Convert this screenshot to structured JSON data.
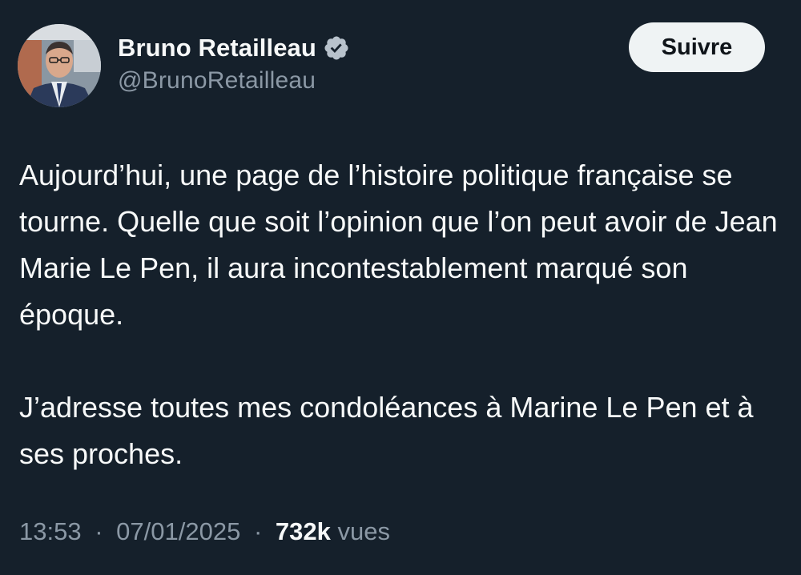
{
  "author": {
    "display_name": "Bruno Retailleau",
    "handle": "@BrunoRetailleau",
    "verified_icon": "verified-badge-icon",
    "avatar": "profile-photo"
  },
  "follow_button": {
    "label": "Suivre"
  },
  "tweet": {
    "paragraphs": [
      "Aujourd’hui, une page de l’histoire politique française se tourne. Quelle que soit l’opinion que l’on peut avoir de Jean Marie Le Pen, il aura incontestablement marqué son époque.",
      "J’adresse toutes mes condoléances à Marine Le Pen et à ses proches."
    ]
  },
  "meta": {
    "time": "13:53",
    "separator": "·",
    "date": "07/01/2025",
    "views_count": "732k",
    "views_label": "vues"
  },
  "colors": {
    "background": "#15202b",
    "text_primary": "#f7f9f9",
    "text_secondary": "#8b98a5",
    "follow_button_bg": "#eff3f4",
    "verified_badge": "#b8c2cc"
  }
}
